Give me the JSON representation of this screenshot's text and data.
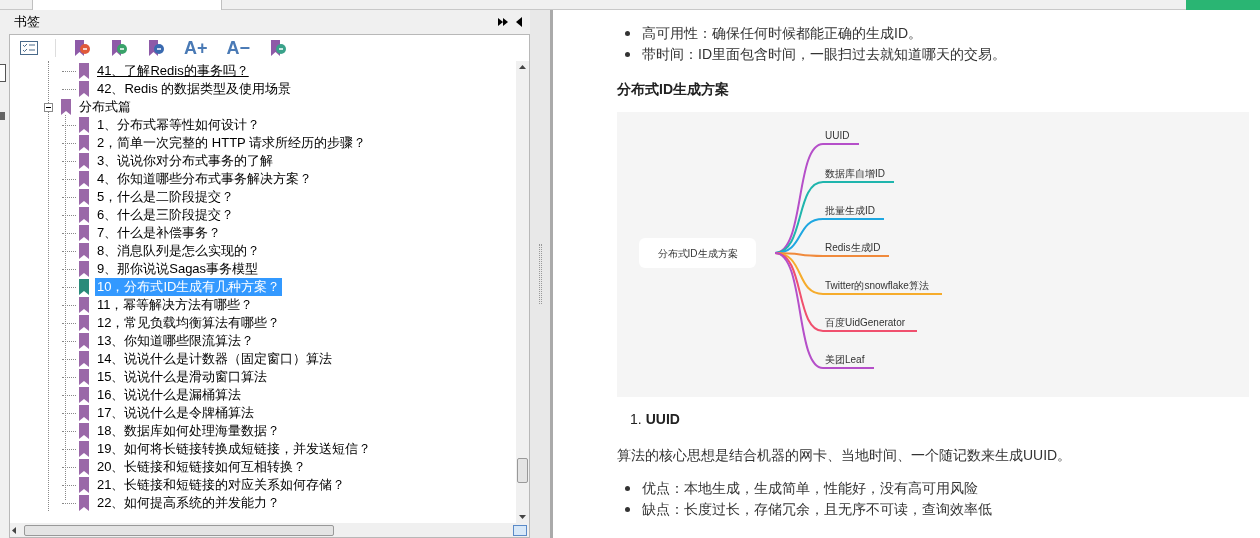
{
  "bookmarks_panel": {
    "title": "书签",
    "toolbar": [
      {
        "kind": "checklist"
      },
      {
        "kind": "bookmark-remove"
      },
      {
        "kind": "bookmark-add"
      },
      {
        "kind": "bookmark-edit"
      },
      {
        "kind": "text",
        "label": "A+"
      },
      {
        "kind": "text",
        "label": "A−"
      },
      {
        "kind": "bookmark-check"
      }
    ],
    "tree": {
      "continued_items": [
        {
          "label": "41、了解Redis的事务吗？",
          "hovered": true,
          "selected": false
        },
        {
          "label": "42、Redis 的数据类型及使用场景",
          "hovered": false,
          "selected": false
        }
      ],
      "sections": [
        {
          "label": "分布式篇",
          "expanded": true,
          "children": [
            {
              "label": "1、分布式幂等性如何设计？",
              "hovered": false,
              "selected": false
            },
            {
              "label": "2，简单一次完整的 HTTP 请求所经历的步骤？",
              "hovered": false,
              "selected": false
            },
            {
              "label": "3、说说你对分布式事务的了解",
              "hovered": false,
              "selected": false
            },
            {
              "label": "4、你知道哪些分布式事务解决方案？",
              "hovered": false,
              "selected": false
            },
            {
              "label": "5，什么是二阶段提交？",
              "hovered": false,
              "selected": false
            },
            {
              "label": "6、什么是三阶段提交？",
              "hovered": false,
              "selected": false
            },
            {
              "label": "7、什么是补偿事务？",
              "hovered": false,
              "selected": false
            },
            {
              "label": "8、消息队列是怎么实现的？",
              "hovered": false,
              "selected": false
            },
            {
              "label": "9、那你说说Sagas事务模型",
              "hovered": false,
              "selected": false
            },
            {
              "label": "10，分布式ID生成有几种方案？",
              "hovered": false,
              "selected": true
            },
            {
              "label": "11，幂等解决方法有哪些？",
              "hovered": false,
              "selected": false
            },
            {
              "label": "12，常见负载均衡算法有哪些？",
              "hovered": false,
              "selected": false
            },
            {
              "label": "13、你知道哪些限流算法？",
              "hovered": false,
              "selected": false
            },
            {
              "label": "14、说说什么是计数器（固定窗口）算法",
              "hovered": false,
              "selected": false
            },
            {
              "label": "15、说说什么是滑动窗口算法",
              "hovered": false,
              "selected": false
            },
            {
              "label": "16、说说什么是漏桶算法",
              "hovered": false,
              "selected": false
            },
            {
              "label": "17、说说什么是令牌桶算法",
              "hovered": false,
              "selected": false
            },
            {
              "label": "18、数据库如何处理海量数据？",
              "hovered": false,
              "selected": false
            },
            {
              "label": "19、如何将长链接转换成短链接，并发送短信？",
              "hovered": false,
              "selected": false
            },
            {
              "label": "20、长链接和短链接如何互相转换？",
              "hovered": false,
              "selected": false
            },
            {
              "label": "21、长链接和短链接的对应关系如何存储？",
              "hovered": false,
              "selected": false
            },
            {
              "label": "22、如何提高系统的并发能力？",
              "hovered": false,
              "selected": false
            }
          ]
        }
      ]
    }
  },
  "document": {
    "bullets_top": [
      "高可用性：确保任何时候都能正确的生成ID。",
      "带时间：ID里面包含时间，一眼扫过去就知道哪天的交易。"
    ],
    "heading": "分布式ID生成方案",
    "mindmap": {
      "center": "分布式ID生成方案",
      "branches": [
        {
          "label": "UUID",
          "color": "#b54fc9"
        },
        {
          "label": "数据库自增ID",
          "color": "#1fb5ad"
        },
        {
          "label": "批量生成ID",
          "color": "#1ea7e1"
        },
        {
          "label": "Redis生成ID",
          "color": "#f08a3c"
        },
        {
          "label": "Twitter的snowflake算法",
          "color": "#f6ac2c"
        },
        {
          "label": "百度UidGenerator",
          "color": "#f0506e"
        },
        {
          "label": "美团Leaf",
          "color": "#b54fc9"
        }
      ]
    },
    "numbered_heading": {
      "number": "1.",
      "text": "UUID"
    },
    "paragraph": "算法的核心思想是结合机器的网卡、当地时间、一个随记数来生成UUID。",
    "bullets_bottom": [
      "优点：本地生成，生成简单，性能好，没有高可用风险",
      "缺点：长度过长，存储冗余，且无序不可读，查询效率低"
    ]
  }
}
